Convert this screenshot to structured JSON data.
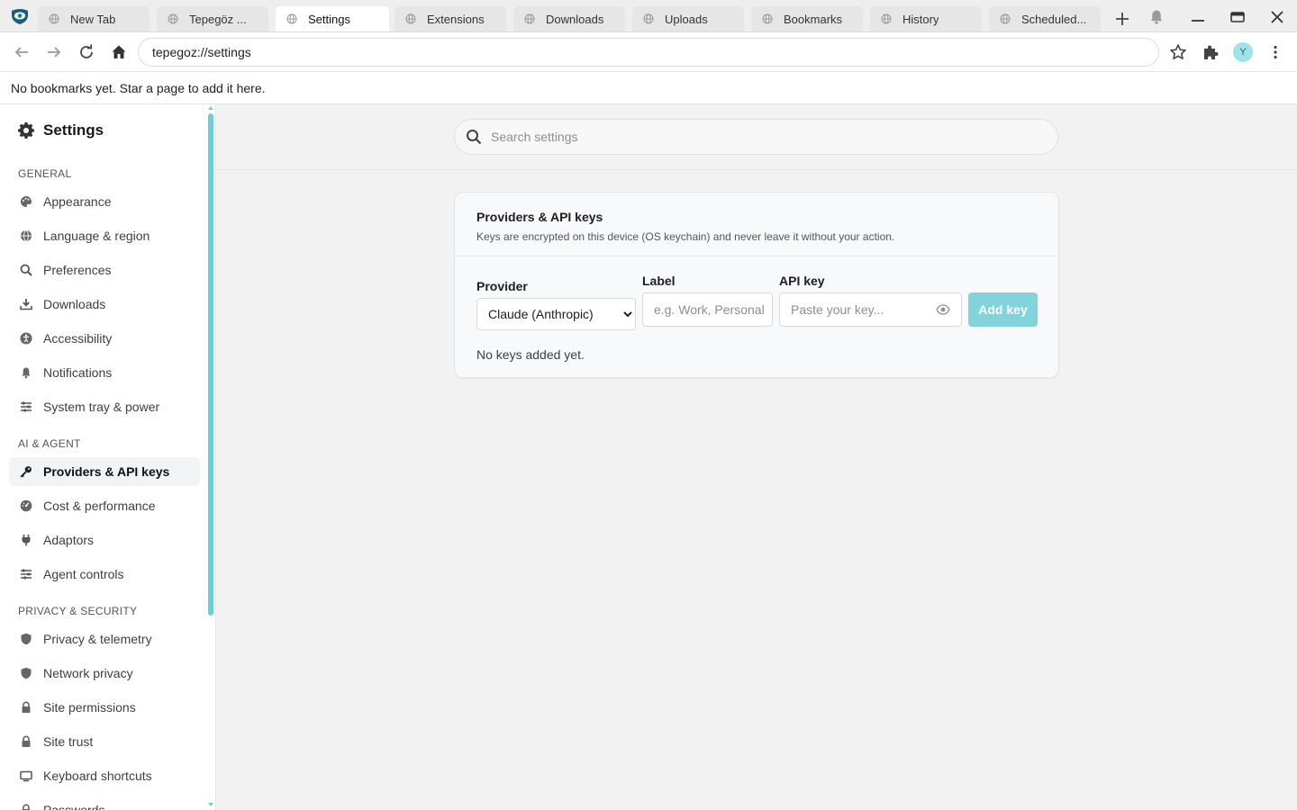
{
  "tabs": [
    {
      "label": "New Tab",
      "active": false
    },
    {
      "label": "Tepegöz ...",
      "active": false
    },
    {
      "label": "Settings",
      "active": true
    },
    {
      "label": "Extensions",
      "active": false
    },
    {
      "label": "Downloads",
      "active": false
    },
    {
      "label": "Uploads",
      "active": false
    },
    {
      "label": "Bookmarks",
      "active": false
    },
    {
      "label": "History",
      "active": false
    },
    {
      "label": "Scheduled...",
      "active": false
    }
  ],
  "toolbar": {
    "url": "tepegoz://settings",
    "avatar_initial": "Y"
  },
  "bookmarks_bar": {
    "empty_text": "No bookmarks yet. Star a page to add it here."
  },
  "sidebar": {
    "title": "Settings",
    "sections": [
      {
        "header": "GENERAL",
        "items": [
          {
            "label": "Appearance",
            "icon": "palette-icon"
          },
          {
            "label": "Language & region",
            "icon": "globe-icon"
          },
          {
            "label": "Preferences",
            "icon": "search-icon"
          },
          {
            "label": "Downloads",
            "icon": "download-icon"
          },
          {
            "label": "Accessibility",
            "icon": "accessibility-icon"
          },
          {
            "label": "Notifications",
            "icon": "bell-icon"
          },
          {
            "label": "System tray & power",
            "icon": "sliders-icon"
          }
        ]
      },
      {
        "header": "AI & AGENT",
        "items": [
          {
            "label": "Providers & API keys",
            "icon": "key-icon",
            "active": true
          },
          {
            "label": "Cost & performance",
            "icon": "gauge-icon"
          },
          {
            "label": "Adaptors",
            "icon": "plug-icon"
          },
          {
            "label": "Agent controls",
            "icon": "sliders-icon"
          }
        ]
      },
      {
        "header": "PRIVACY & SECURITY",
        "items": [
          {
            "label": "Privacy & telemetry",
            "icon": "shield-icon"
          },
          {
            "label": "Network privacy",
            "icon": "shield-icon"
          },
          {
            "label": "Site permissions",
            "icon": "lock-icon"
          },
          {
            "label": "Site trust",
            "icon": "lock-icon"
          },
          {
            "label": "Keyboard shortcuts",
            "icon": "keyboard-icon"
          },
          {
            "label": "Passwords",
            "icon": "lock-icon"
          }
        ]
      }
    ]
  },
  "search": {
    "placeholder": "Search settings"
  },
  "card": {
    "title": "Providers & API keys",
    "description": "Keys are encrypted on this device (OS keychain) and never leave it without your action.",
    "provider_label": "Provider",
    "provider_selected": "Claude (Anthropic)",
    "label_label": "Label",
    "label_placeholder": "e.g. Work, Personal",
    "api_key_label": "API key",
    "api_key_placeholder": "Paste your key...",
    "add_button": "Add key",
    "empty_state": "No keys added yet."
  },
  "colors": {
    "accent": "#82d4dc",
    "scrollbar": "#6ccfd8",
    "logo": "#1b5e7a"
  }
}
